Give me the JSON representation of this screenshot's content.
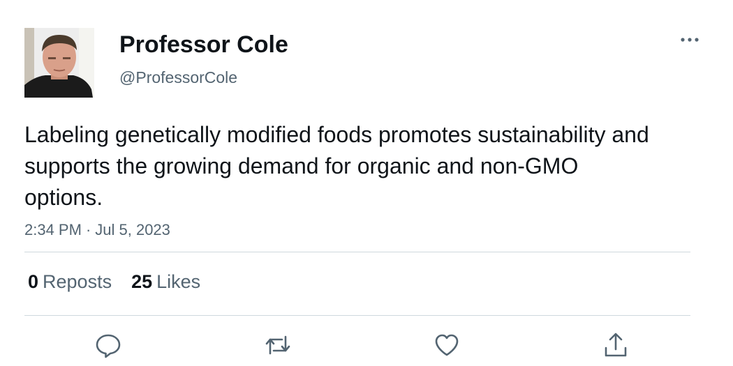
{
  "author": {
    "display_name": "Professor Cole",
    "handle": "@ProfessorCole",
    "avatar_icon": "profile-photo"
  },
  "tweet": {
    "text": "Labeling genetically modified foods promotes sustainability and supports the growing demand for organic and non-GMO options.",
    "time": "2:34 PM",
    "separator": "·",
    "date": "Jul 5, 2023"
  },
  "stats": {
    "reposts_count": "0",
    "reposts_label": "Reposts",
    "likes_count": "25",
    "likes_label": "Likes"
  },
  "actions": [
    {
      "name": "reply",
      "icon": "speech-bubble-icon"
    },
    {
      "name": "repost",
      "icon": "repost-arrows-icon"
    },
    {
      "name": "like",
      "icon": "heart-icon"
    },
    {
      "name": "share",
      "icon": "share-upload-icon"
    }
  ],
  "colors": {
    "text_primary": "#0f1419",
    "text_secondary": "#536471",
    "divider": "#cfd9de"
  }
}
